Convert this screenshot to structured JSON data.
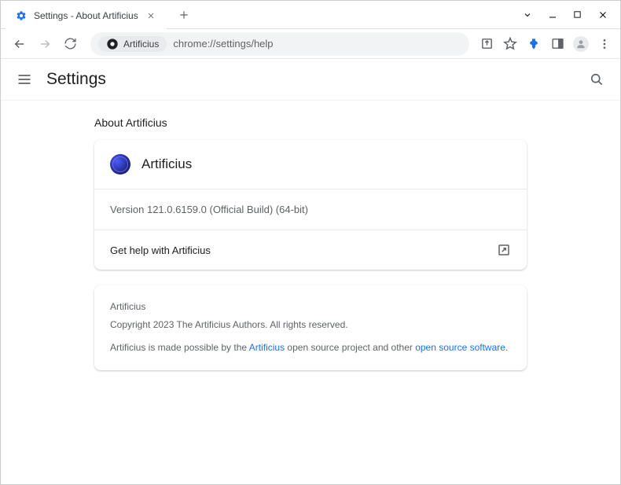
{
  "window": {
    "tab_title": "Settings - About Artificius",
    "site_name": "Artificius",
    "url": "chrome://settings/help"
  },
  "settings": {
    "title": "Settings"
  },
  "about": {
    "section_title": "About Artificius",
    "app_name": "Artificius",
    "version_line": "Version 121.0.6159.0 (Official Build) (64-bit)",
    "help_label": "Get help with Artificius"
  },
  "info": {
    "name": "Artificius",
    "copyright": "Copyright 2023 The Artificius Authors. All rights reserved.",
    "prefix": "Artificius is made possible by the ",
    "link1": "Artificius",
    "mid": " open source project and other ",
    "link2": "open source software",
    "suffix": "."
  }
}
